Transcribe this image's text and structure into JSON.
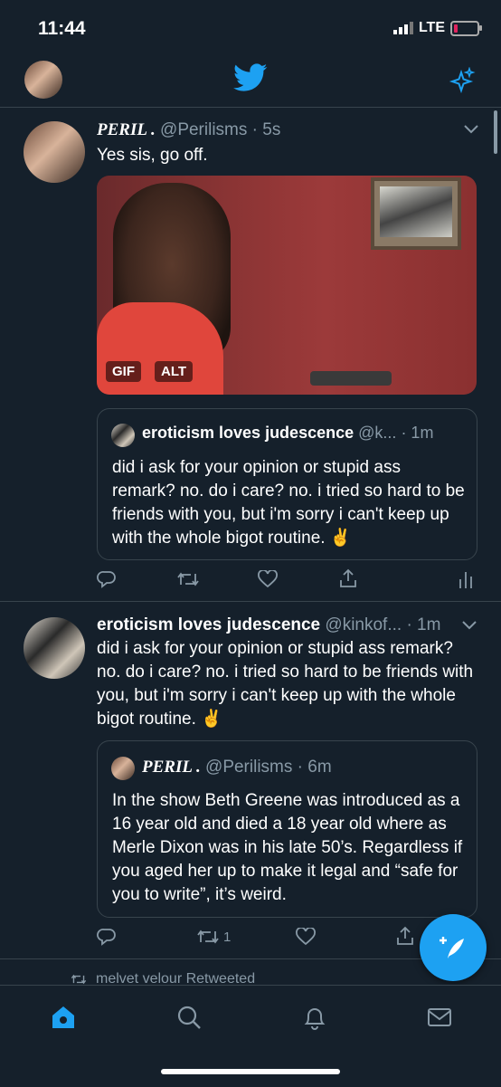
{
  "status_bar": {
    "time": "11:44",
    "network": "LTE"
  },
  "colors": {
    "background": "#15202b",
    "accent": "#1da1f2",
    "muted": "#8899a6",
    "border": "#38444d"
  },
  "header": {
    "logo_icon": "twitter-bird-icon",
    "sparkle_icon": "sparkle-icon"
  },
  "tweets": [
    {
      "display_name": "PERIL .",
      "handle": "@Perilisms",
      "time": "· 5s",
      "text": "Yes sis, go off.",
      "media": {
        "badges": [
          "GIF",
          "ALT"
        ]
      },
      "quote": {
        "display_name": "eroticism loves judescence",
        "handle": "@k...",
        "time": "· 1m",
        "text": "did i ask for your opinion or stupid ass remark? no. do i care? no. i tried so hard to be friends with you, but i'm sorry i can't keep up with the whole bigot routine. ✌️"
      }
    },
    {
      "display_name": "eroticism loves judescence",
      "handle": "@kinkof...",
      "time": "· 1m",
      "text": "did i ask for your opinion or stupid ass remark? no. do i care? no. i tried so hard to be friends with you, but i'm sorry i can't keep up with the whole bigot routine. ✌️",
      "quote": {
        "display_name": "PERIL .",
        "handle": "@Perilisms",
        "time": "· 6m",
        "text": "In the show Beth Greene was introduced as a 16 year old and died a 18 year old where as Merle Dixon was in his late 50’s. Regardless if you aged her up to make it legal and “safe for you to write”, it’s weird."
      },
      "retweet_count": "1"
    }
  ],
  "retweet_banner": "melvet velour Retweeted"
}
